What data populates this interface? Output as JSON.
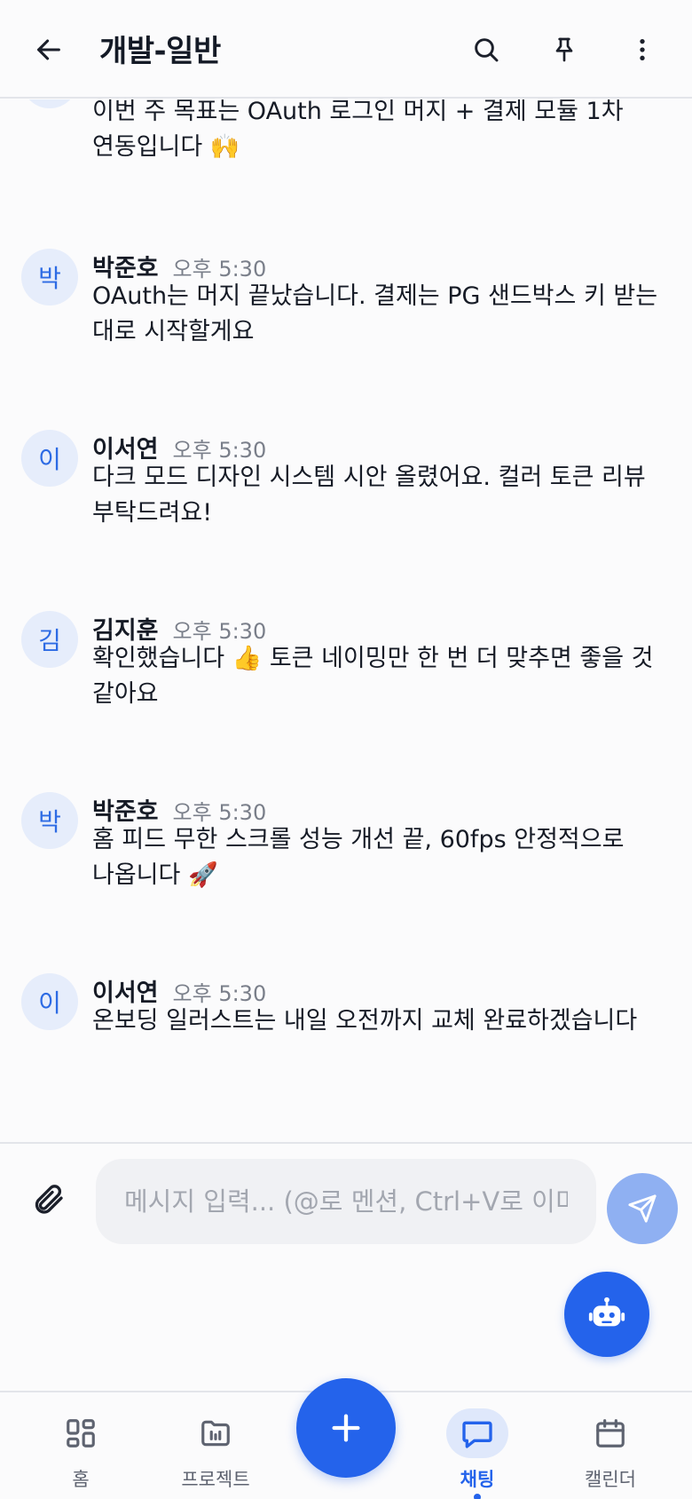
{
  "header": {
    "title": "개발-일반",
    "back_icon": "arrow-left-icon",
    "actions": [
      "search-icon",
      "pin-icon",
      "more-vertical-icon"
    ]
  },
  "messages": [
    {
      "avatar": "",
      "sender": "",
      "time": "",
      "text": "이번 주 목표는 OAuth 로그인 머지 + 결제 모듈 1차 연동입니다 🙌"
    },
    {
      "avatar": "박",
      "sender": "박준호",
      "time": "오후 5:30",
      "text": "OAuth는 머지 끝났습니다. 결제는 PG 샌드박스 키 받는 대로 시작할게요"
    },
    {
      "avatar": "이",
      "sender": "이서연",
      "time": "오후 5:30",
      "text": "다크 모드 디자인 시스템 시안 올렸어요. 컬러 토큰 리뷰 부탁드려요!"
    },
    {
      "avatar": "김",
      "sender": "김지훈",
      "time": "오후 5:30",
      "text": "확인했습니다 👍 토큰 네이밍만 한 번 더 맞추면 좋을 것 같아요"
    },
    {
      "avatar": "박",
      "sender": "박준호",
      "time": "오후 5:30",
      "text": "홈 피드 무한 스크롤 성능 개선 끝, 60fps 안정적으로 나옵니다 🚀"
    },
    {
      "avatar": "이",
      "sender": "이서연",
      "time": "오후 5:30",
      "text": "온보딩 일러스트는 내일 오전까지 교체 완료하겠습니다"
    }
  ],
  "composer": {
    "placeholder": "메시지 입력... (@로 멘션, Ctrl+V로 이미지 붙여넣기)",
    "value": "",
    "attach_icon": "paperclip-icon",
    "send_icon": "send-icon"
  },
  "bot_fab_icon": "robot-icon",
  "bottom_nav": {
    "add_icon": "plus-icon",
    "items": [
      {
        "label": "홈",
        "icon": "grid-icon",
        "active": false
      },
      {
        "label": "프로젝트",
        "icon": "folder-icon",
        "active": false
      },
      {
        "label": "채팅",
        "icon": "chat-bubble-icon",
        "active": true
      },
      {
        "label": "캘린더",
        "icon": "calendar-icon",
        "active": false
      }
    ]
  },
  "colors": {
    "primary": "#2463eb",
    "send_disabled": "#8fb0f2",
    "avatar_bg": "#e6edfb",
    "avatar_text": "#2d6be4"
  }
}
